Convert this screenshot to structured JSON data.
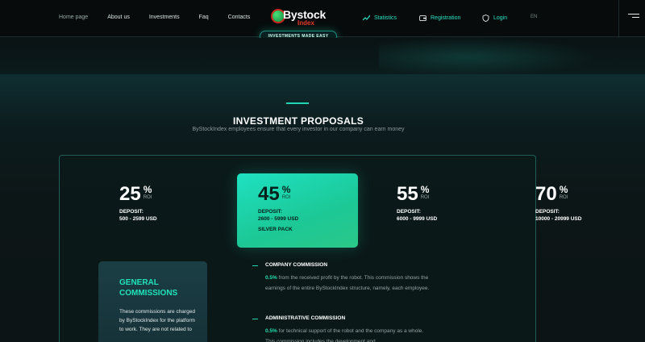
{
  "nav": {
    "home": "Home page",
    "about": "About us",
    "investments": "Investments",
    "faq": "Faq",
    "contacts": "Contacts"
  },
  "logo": {
    "name": "Bystock",
    "sub": "Index",
    "tagline": "INVESTMENTS MADE EASY"
  },
  "header_right": {
    "statistics": "Statistics",
    "registration": "Registration",
    "login": "Login",
    "lang": "EN"
  },
  "section": {
    "title": "INVESTMENT PROPOSALS",
    "subtitle": "ByStockIndex employees ensure that every investor in our company can earn money"
  },
  "plans": [
    {
      "percent": "25",
      "sign": "%",
      "roi": "ROI",
      "deposit_label": "DEPOSIT:",
      "range": "500 - 2599 USD"
    },
    {
      "percent": "45",
      "sign": "%",
      "roi": "ROI",
      "deposit_label": "DEPOSIT:",
      "range": "2600 - 5999 USD",
      "pack": "SILVER PACK"
    },
    {
      "percent": "55",
      "sign": "%",
      "roi": "ROI",
      "deposit_label": "DEPOSIT:",
      "range": "6000 - 9999 USD"
    },
    {
      "percent": "70",
      "sign": "%",
      "roi": "ROI",
      "deposit_label": "DEPOSIT:",
      "range": "10000 - 20999 USD"
    }
  ],
  "general": {
    "title_1": "GENERAL",
    "title_2": "COMMISSIONS",
    "text": "These commissions are charged by ByStockIndex for the platform to work. They are not related to"
  },
  "commissions": [
    {
      "title": "COMPANY COMMISSION",
      "highlight": "0.5%",
      "text": " from the received profit by the robot. This commission shows the earnings of the entire ByStockIndex structure, namely, each employee."
    },
    {
      "title": "ADMINISTRATIVE COMMISSION",
      "highlight": "0.5%",
      "text": " for technical support of the robot and the company as a whole. This commission includes the development and"
    }
  ],
  "colors": {
    "accent": "#1fd6b6",
    "background": "#0c1416",
    "card_featured": "#1ee1c2"
  }
}
